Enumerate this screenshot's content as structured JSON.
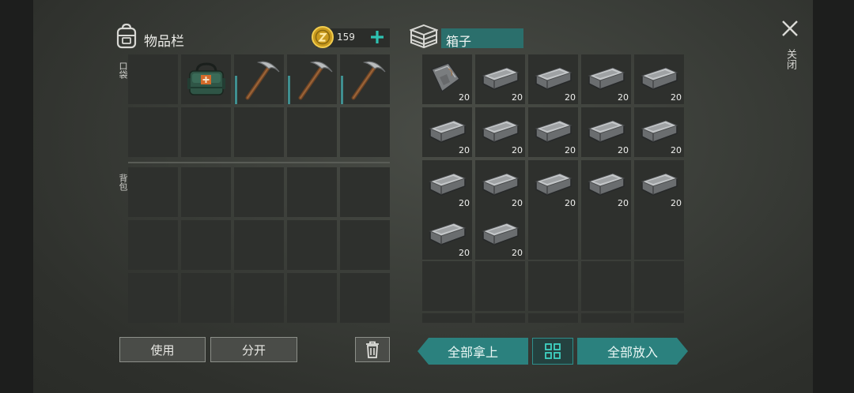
{
  "inventory": {
    "title": "物品栏",
    "pocket_label": "口袋",
    "backpack_label": "背包",
    "coins": "159",
    "pocket_slots": [
      {
        "icon": "empty-slot"
      },
      {
        "icon": "medical-bag-icon"
      },
      {
        "icon": "pickaxe-icon",
        "marked": true
      },
      {
        "icon": "pickaxe-icon",
        "marked": true
      },
      {
        "icon": "pickaxe-icon",
        "marked": true
      },
      {
        "icon": "empty-slot"
      },
      {
        "icon": "empty-slot"
      },
      {
        "icon": "empty-slot"
      },
      {
        "icon": "empty-slot"
      },
      {
        "icon": "empty-slot"
      }
    ],
    "backpack_slot_count": 15,
    "use_label": "使用",
    "split_label": "分开"
  },
  "chest": {
    "title": "箱子",
    "slots": [
      {
        "icon": "iron-plate-icon",
        "qty": "20"
      },
      {
        "icon": "iron-ingot-icon",
        "qty": "20"
      },
      {
        "icon": "iron-ingot-icon",
        "qty": "20"
      },
      {
        "icon": "iron-ingot-icon",
        "qty": "20"
      },
      {
        "icon": "iron-ingot-icon",
        "qty": "20"
      },
      {
        "icon": "iron-ingot-icon",
        "qty": "20"
      },
      {
        "icon": "iron-ingot-icon",
        "qty": "20"
      },
      {
        "icon": "iron-ingot-icon",
        "qty": "20"
      },
      {
        "icon": "iron-ingot-icon",
        "qty": "20"
      },
      {
        "icon": "iron-ingot-icon",
        "qty": "20"
      },
      {
        "icon": "iron-ingot-icon",
        "qty": "20"
      },
      {
        "icon": "iron-ingot-icon",
        "qty": "20"
      },
      {
        "icon": "iron-ingot-icon",
        "qty": "20"
      },
      {
        "icon": "iron-ingot-icon",
        "qty": "20"
      },
      {
        "icon": "iron-ingot-icon",
        "qty": "20"
      },
      {
        "icon": "iron-ingot-icon",
        "qty": "20"
      },
      {
        "icon": "iron-ingot-icon",
        "qty": "20"
      }
    ],
    "total_slot_count": 30,
    "take_all_label": "全部拿上",
    "put_all_label": "全部放入"
  },
  "close_label": "关闭",
  "colors": {
    "accent": "#2d8f8c",
    "slot": "#2e302d"
  }
}
